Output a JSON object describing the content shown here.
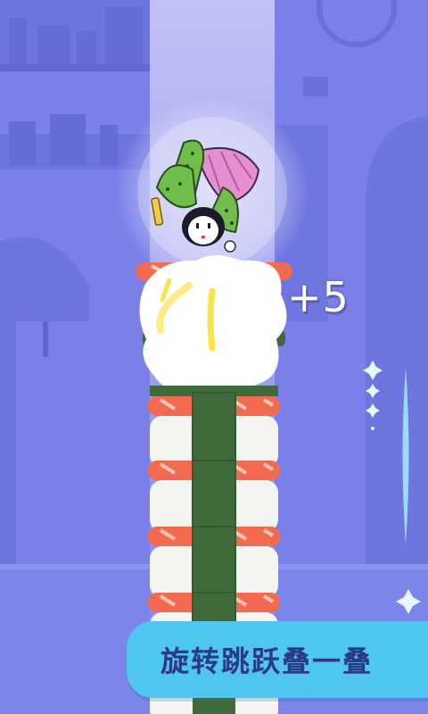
{
  "game": {
    "score_popup": "+5",
    "banner_text": "旋转跳跃叠一叠"
  },
  "colors": {
    "background": "#7a80e8",
    "light_beam": "#c9c6f6",
    "banner": "#4fc6f0",
    "banner_text": "#2a3a86",
    "salmon": "#f26a4f",
    "rice": "#f4f4f0",
    "nori": "#3f6b3a",
    "kimono": "#6fbd4a"
  },
  "icons": {
    "character": "doll-character-icon",
    "sparkle": "sparkle-icon"
  }
}
